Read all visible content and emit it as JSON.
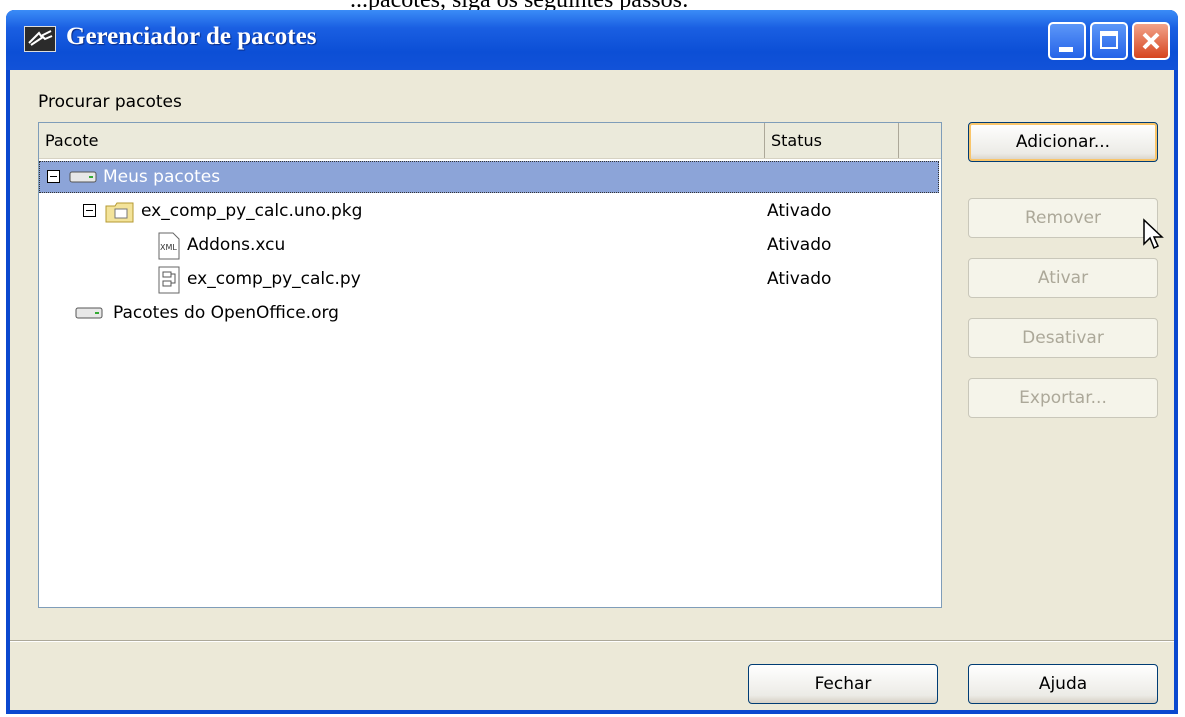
{
  "window": {
    "title": "Gerenciador de pacotes"
  },
  "browse_label": "Procurar pacotes",
  "columns": {
    "package": "Pacote",
    "status": "Status"
  },
  "tree": [
    {
      "label": "Meus pacotes",
      "status": "",
      "selected": true
    },
    {
      "label": "ex_comp_py_calc.uno.pkg",
      "status": "Ativado"
    },
    {
      "label": "Addons.xcu",
      "status": "Ativado"
    },
    {
      "label": "ex_comp_py_calc.py",
      "status": "Ativado"
    },
    {
      "label": "Pacotes do OpenOffice.org",
      "status": ""
    }
  ],
  "buttons": {
    "add": "Adicionar...",
    "remove": "Remover",
    "activate": "Ativar",
    "deactivate": "Desativar",
    "export": "Exportar...",
    "close": "Fechar",
    "help": "Ajuda"
  },
  "colors": {
    "title_bar": "#0c4fd6",
    "selection": "#8ca4d8",
    "dialog_bg": "#ece9d8",
    "close_button": "#d6451f"
  }
}
